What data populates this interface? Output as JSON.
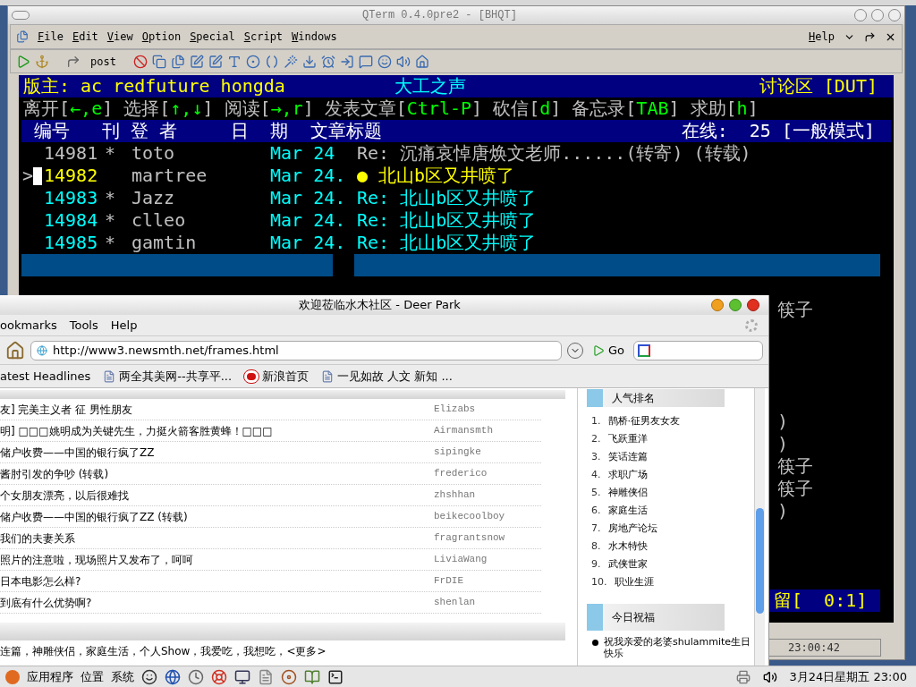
{
  "qterm": {
    "title": "QTerm 0.4.0pre2 - [BHQT]",
    "menu": [
      "File",
      "Edit",
      "View",
      "Option",
      "Special",
      "Script",
      "Windows"
    ],
    "help_menu": "Help",
    "post_button": "post",
    "terminal": {
      "header": {
        "moderator": "版主: ac redfuture hongda",
        "board": "大工之声",
        "zone": "讨论区 [DUT]"
      },
      "help_line": [
        {
          "kind": "text",
          "text": "离开["
        },
        {
          "kind": "key",
          "text": "←,e"
        },
        {
          "kind": "text",
          "text": "] 选择["
        },
        {
          "kind": "key",
          "text": "↑,↓"
        },
        {
          "kind": "text",
          "text": "] 阅读["
        },
        {
          "kind": "key",
          "text": "→,r"
        },
        {
          "kind": "text",
          "text": "] 发表文章["
        },
        {
          "kind": "key",
          "text": "Ctrl-P"
        },
        {
          "kind": "text",
          "text": "] 砍信["
        },
        {
          "kind": "key",
          "text": "d"
        },
        {
          "kind": "text",
          "text": "] 备忘录["
        },
        {
          "kind": "key",
          "text": "TAB"
        },
        {
          "kind": "text",
          "text": "] 求助["
        },
        {
          "kind": "key",
          "text": "h"
        },
        {
          "kind": "text",
          "text": "]"
        }
      ],
      "column_bar": {
        "columns": "编号   刊 登 者     日  期  文章标题",
        "online": "在线:  25 [一般模式]"
      },
      "cursor": ">",
      "rows": [
        {
          "kind": "post",
          "number": "14981",
          "mark": "*",
          "author": "toto",
          "date": "Mar 24",
          "title": "Re: 沉痛哀悼唐焕文老师......(转寄) (转载)",
          "color": "#c0c0c0",
          "selected": false
        },
        {
          "kind": "post",
          "number": "14982",
          "author": "martree",
          "date": "Mar 24.",
          "title": "● 北山b区又井喷了",
          "color": "#ffff00",
          "selected": true
        },
        {
          "kind": "post",
          "number": "14983",
          "mark": "*",
          "author": "Jazz",
          "date": "Mar 24.",
          "title": "Re: 北山b区又井喷了",
          "color": "#00ffff",
          "selected": false
        },
        {
          "kind": "post",
          "number": "14984",
          "mark": "*",
          "author": "clleo",
          "date": "Mar 24.",
          "title": "Re: 北山b区又井喷了",
          "color": "#00ffff",
          "selected": false
        },
        {
          "kind": "post",
          "number": "14985",
          "mark": "*",
          "author": "gamtin",
          "date": "Mar 24.",
          "title": "Re: 北山b区又井喷了",
          "color": "#00ffff",
          "selected": false
        },
        {
          "kind": "bar"
        },
        {
          "kind": "blank"
        }
      ],
      "fragments": [
        {
          "kind": "text",
          "text": "筷子"
        },
        {
          "kind": "blank"
        },
        {
          "kind": "blank"
        },
        {
          "kind": "blank"
        },
        {
          "kind": "blank"
        },
        {
          "kind": "text",
          "text": ")"
        },
        {
          "kind": "text",
          "text": ")"
        },
        {
          "kind": "text",
          "text": "筷子"
        },
        {
          "kind": "text",
          "text": "筷子"
        },
        {
          "kind": "text",
          "text": ")"
        },
        {
          "kind": "blank"
        },
        {
          "kind": "blank"
        },
        {
          "kind": "blank"
        },
        {
          "kind": "status",
          "text": "留[  0:1]"
        }
      ]
    },
    "status_time": "23:00:42"
  },
  "browser": {
    "title": "欢迎莅临水木社区 - Deer Park",
    "menu": [
      "ookmarks",
      "Tools",
      "Help"
    ],
    "url": "http://www3.newsmth.net/frames.html",
    "go": "Go",
    "bookmarks": [
      {
        "kind": "plain",
        "label": "atest Headlines"
      },
      {
        "kind": "page",
        "label": "两全其美网--共享平..."
      },
      {
        "kind": "site",
        "label": "新浪首页"
      },
      {
        "kind": "page",
        "label": "一见如故 人文 新知 ..."
      }
    ],
    "posts": [
      {
        "title": "友] 完美主义者 征 男性朋友",
        "author": "Elizabs"
      },
      {
        "title": "明] □□□姚明成为关键先生，力挺火箭客胜黄蜂！□□□",
        "author": "Airmansmth"
      },
      {
        "title": "储户收费——中国的银行疯了ZZ",
        "author": "sipingke"
      },
      {
        "title": "酱肘引发的争吵 (转载)",
        "author": "frederico"
      },
      {
        "title": "个女朋友漂亮，以后很难找",
        "author": "zhshhan"
      },
      {
        "title": "储户收费——中国的银行疯了ZZ (转载)",
        "author": "beikecoolboy"
      },
      {
        "title": "我们的夫妻关系",
        "author": "fragrantsnow"
      },
      {
        "title": "照片的注意啦，现场照片又发布了，呵呵",
        "author": "LiviaWang"
      },
      {
        "title": "日本电影怎么样?",
        "author": "FrDIE"
      },
      {
        "title": "到底有什么优势啊?",
        "author": "shenlan"
      }
    ],
    "board_line": "连篇，神雕侠侣，家庭生活，个人Show，我爱吃，我想吃，<更多>",
    "sidebar": {
      "ranking_title": "人气排名",
      "ranking": [
        {
          "rank": "1.",
          "name": "鹊桥·征男友女友"
        },
        {
          "rank": "2.",
          "name": "飞跃重洋"
        },
        {
          "rank": "3.",
          "name": "笑话连篇"
        },
        {
          "rank": "4.",
          "name": "求职广场"
        },
        {
          "rank": "5.",
          "name": "神雕侠侣"
        },
        {
          "rank": "6.",
          "name": "家庭生活"
        },
        {
          "rank": "7.",
          "name": "房地产论坛"
        },
        {
          "rank": "8.",
          "name": "水木特快"
        },
        {
          "rank": "9.",
          "name": "武侠世家"
        },
        {
          "rank": "10.",
          "name": "职业生涯"
        }
      ],
      "wishes_title": "今日祝福",
      "wishes": [
        "祝我亲爱的老婆shulammite生日快乐"
      ]
    }
  },
  "taskbar": {
    "menus": [
      "应用程序",
      "位置",
      "系统"
    ],
    "clock": "3月24日星期五 23:00"
  }
}
